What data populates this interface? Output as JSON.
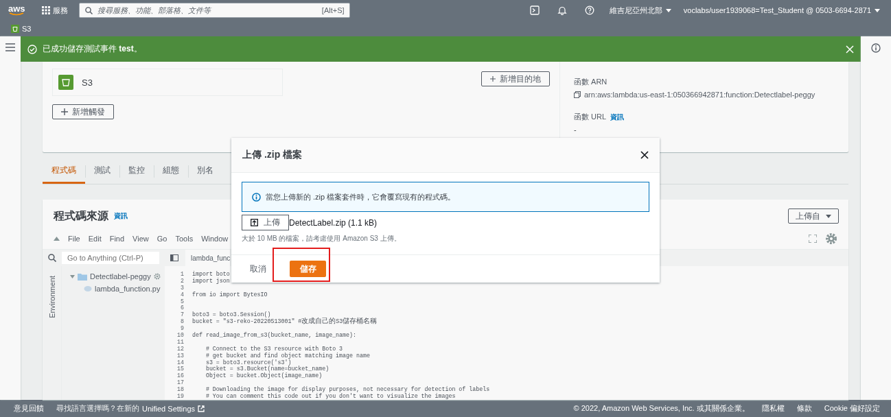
{
  "top_nav": {
    "logo": "aws",
    "services": "服務",
    "search": {
      "placeholder": "搜尋服務、功能、部落格、文件等"
    },
    "shortcut": "[Alt+S]",
    "region": "維吉尼亞州北部",
    "account": "voclabs/user1939068=Test_Student @ 0503-6694-2871"
  },
  "favorites": [
    {
      "label": "S3"
    }
  ],
  "flash": {
    "message": "已成功儲存測試事件 **test**。"
  },
  "overview": {
    "trigger": {
      "name": "S3"
    },
    "add_destination": "新增目的地",
    "add_trigger": "新增觸發",
    "arn_label": "函數 ARN",
    "arn": "arn:aws:lambda:us-east-1:050366942871:function:Detectlabel-peggy",
    "url_label": "函數 URL",
    "url_info": "資訊",
    "url_value": "-"
  },
  "tabs": [
    {
      "label": "程式碼",
      "selected": true
    },
    {
      "label": "測試",
      "selected": false
    },
    {
      "label": "監控",
      "selected": false
    },
    {
      "label": "組態",
      "selected": false
    },
    {
      "label": "別名",
      "selected": false
    }
  ],
  "code_source": {
    "title": "程式碼來源",
    "info": "資訊",
    "upload_from": "上傳自",
    "menu": [
      "File",
      "Edit",
      "Find",
      "View",
      "Go",
      "Tools",
      "Window"
    ],
    "search": {
      "placeholder": "Go to Anything (Ctrl-P)"
    },
    "environment": "Environment",
    "tree": [
      {
        "name": "Detectlabel-peggy",
        "kind": "folder",
        "expanded": true,
        "children": [
          {
            "name": "lambda_function.py",
            "kind": "file"
          }
        ]
      }
    ],
    "editor_tab": "lambda_func",
    "lines": [
      {
        "number": "1",
        "text": "import boto"
      },
      {
        "number": "2",
        "text": "import json"
      },
      {
        "number": "3"
      },
      {
        "number": "4",
        "text": "from io import BytesIO"
      },
      {
        "number": "5"
      },
      {
        "number": "6"
      },
      {
        "number": "7",
        "text": "boto3 = boto3.Session()"
      },
      {
        "number": "8",
        "text": "bucket = \"s3-reko-20220513001\" #改成自己的S3儲存桶名稱"
      },
      {
        "number": "9"
      },
      {
        "number": "10",
        "text": "def read_image_from_s3(bucket_name, image_name):"
      },
      {
        "number": "11"
      },
      {
        "number": "12",
        "text": "    # Connect to the S3 resource with Boto 3"
      },
      {
        "number": "13",
        "text": "    # get bucket and find object matching image name"
      },
      {
        "number": "14",
        "text": "    s3 = boto3.resource('s3')"
      },
      {
        "number": "15",
        "text": "    bucket = s3.Bucket(name=bucket_name)"
      },
      {
        "number": "16",
        "text": "    Object = bucket.Object(image_name)"
      },
      {
        "number": "17"
      },
      {
        "number": "18",
        "text": "    # Downloading the image for display purposes, not necessary for detection of labels"
      },
      {
        "number": "19",
        "text": "    # You can comment this code out if you don't want to visualize the images"
      }
    ]
  },
  "footer": {
    "feedback": "意見回饋",
    "language_hint": "尋找語言選擇嗎？在新的",
    "settings_link": "Unified Settings",
    "copyright": "© 2022, Amazon Web Services, Inc. 或其關係企業。",
    "links": [
      "隱私權",
      "條款",
      "Cookie 偏好設定"
    ]
  },
  "modal": {
    "title": "上傳 .zip 檔案",
    "info": "當您上傳新的 .zip 檔案套件時，它會覆寫現有的程式碼。",
    "upload_button": "上傳",
    "file_name": "DetectLabel.zip (1.1 kB)",
    "hint": "大於 10 MB 的檔案，請考慮使用 Amazon S3 上傳。",
    "buttons": [
      {
        "label": "取消",
        "kind": "link",
        "highlighted": false
      },
      {
        "label": "儲存",
        "kind": "primary",
        "highlighted": true
      }
    ]
  }
}
